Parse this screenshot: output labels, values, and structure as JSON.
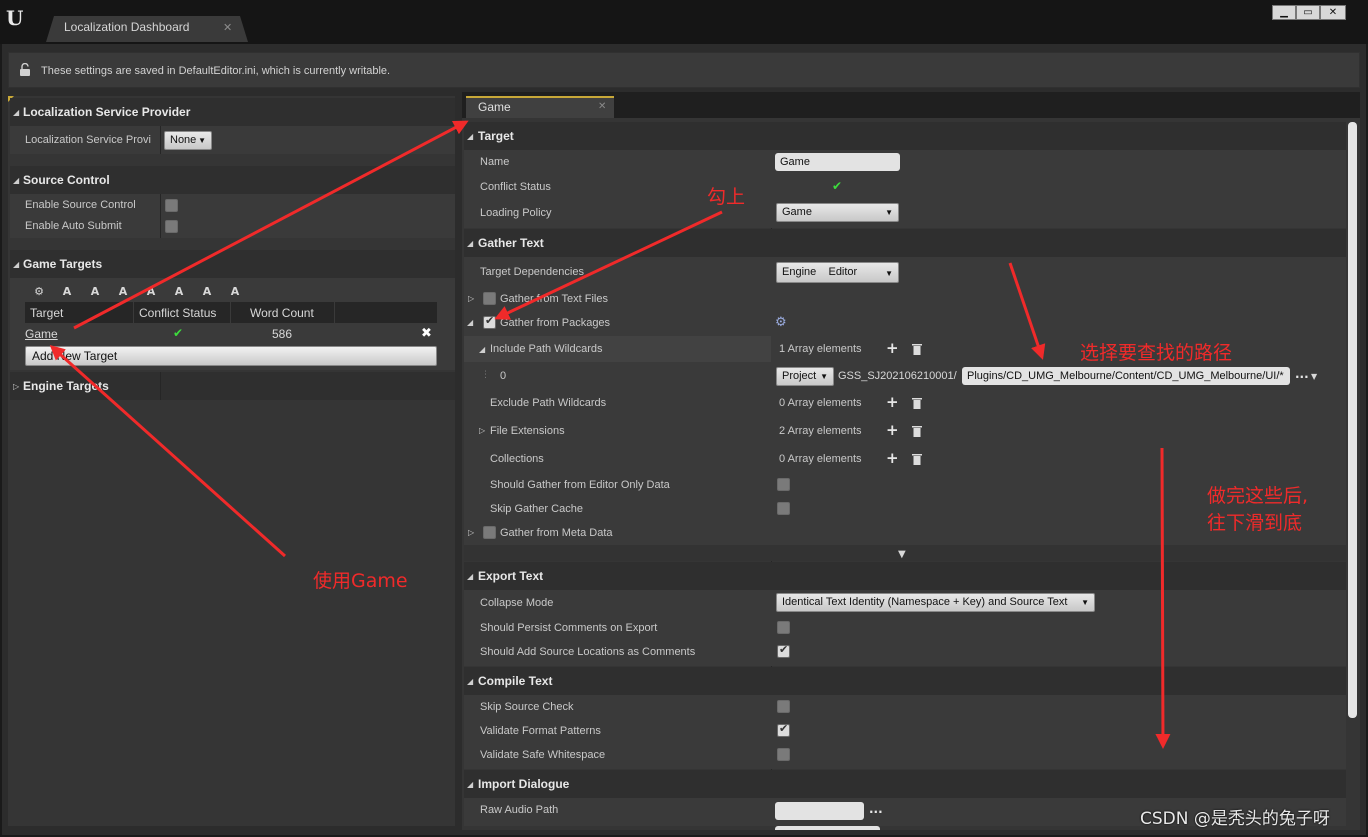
{
  "window": {
    "tab_title": "Localization Dashboard",
    "tab_close": "✕",
    "minimize": "▁",
    "maximize": "▭",
    "close": "✕"
  },
  "info_bar": {
    "icon": "unlock-icon",
    "text": "These settings are saved in DefaultEditor.ini, which is currently writable."
  },
  "left": {
    "lsp_section": "Localization Service Provider",
    "lsp_label": "Localization Service Provi",
    "lsp_value": "None",
    "sc_section": "Source Control",
    "enable_sc": "Enable Source Control",
    "enable_auto": "Enable Auto Submit",
    "gt_section": "Game Targets",
    "table": {
      "headers": [
        "Target",
        "Conflict Status",
        "Word Count"
      ],
      "row": {
        "target": "Game",
        "conflict": "✔",
        "count": "586",
        "delete": "✖"
      }
    },
    "add_target": "Add New Target",
    "engine_section": "Engine Targets"
  },
  "right": {
    "tab": "Game",
    "tab_close": "✕",
    "target_section": "Target",
    "name_label": "Name",
    "name_value": "Game",
    "conflict_label": "Conflict Status",
    "conflict_value": "✔",
    "loading_label": "Loading Policy",
    "loading_value": "Game",
    "gather_section": "Gather Text",
    "deps_label": "Target Dependencies",
    "deps_value": "Engine    Editor",
    "gather_text_files": "Gather from Text Files",
    "gather_packages": "Gather from Packages",
    "include_label": "Include Path Wildcards",
    "include_count": "1 Array elements",
    "item_index": "0",
    "path_root": "Project",
    "path_prefix": "GSS_SJ202106210001/",
    "path_value": "Plugins/CD_UMG_Melbourne/Content/CD_UMG_Melbourne/UI/*",
    "more": "...",
    "exclude_label": "Exclude Path Wildcards",
    "exclude_count": "0 Array elements",
    "ext_label": "File Extensions",
    "ext_count": "2 Array elements",
    "coll_label": "Collections",
    "coll_count": "0 Array elements",
    "editor_only": "Should Gather from Editor Only Data",
    "skip_cache": "Skip Gather Cache",
    "meta_data": "Gather from Meta Data",
    "export_section": "Export Text",
    "collapse_label": "Collapse Mode",
    "collapse_value": "Identical Text Identity (Namespace + Key) and Source Text",
    "persist_label": "Should Persist Comments on Export",
    "add_src_label": "Should Add Source Locations as Comments",
    "compile_section": "Compile Text",
    "skip_src": "Skip Source Check",
    "validate_fmt": "Validate Format Patterns",
    "validate_ws": "Validate Safe Whitespace",
    "import_section": "Import Dialogue",
    "raw_audio": "Raw Audio Path",
    "raw_more": "..."
  },
  "annotations": {
    "check": "勾上",
    "choose_path": "选择要查找的路径",
    "use_game": "使用Game",
    "after_1": "做完这些后,",
    "after_2": "往下滑到底"
  },
  "watermark": "CSDN @是秃头的兔子呀",
  "colors": {
    "accent_tab": "#c8a838",
    "check_green": "#3ddc3d",
    "annotation": "#f02a2a"
  }
}
